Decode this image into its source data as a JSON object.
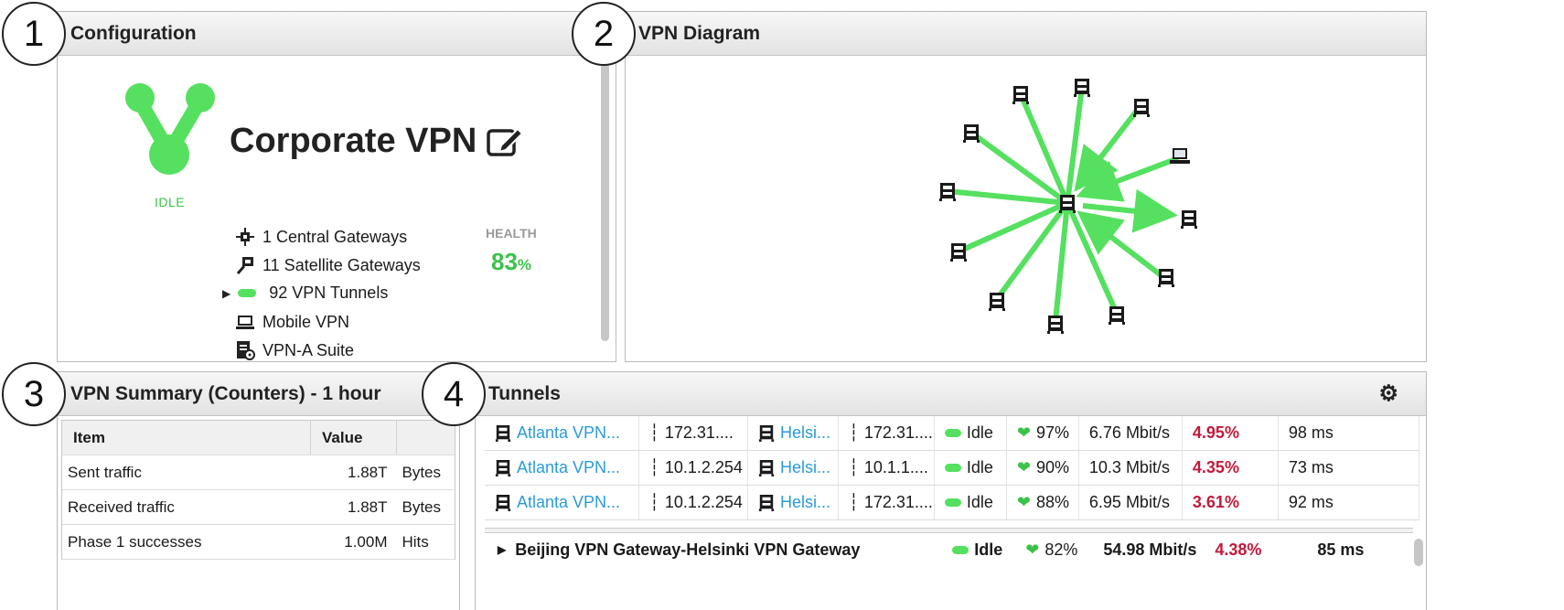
{
  "callouts": [
    "1",
    "2",
    "3",
    "4"
  ],
  "config": {
    "title": "Configuration",
    "vpn_name": "Corporate VPN",
    "status": "IDLE",
    "health_label": "HEALTH",
    "health_value": "83",
    "health_unit": "%",
    "items": [
      {
        "icon": "central-gateway-icon",
        "label": "1 Central Gateways"
      },
      {
        "icon": "satellite-gateway-icon",
        "label": "11 Satellite Gateways"
      },
      {
        "icon": "vpn-tunnel-icon",
        "label": "92 VPN Tunnels"
      },
      {
        "icon": "mobile-vpn-icon",
        "label": "Mobile VPN"
      },
      {
        "icon": "vpn-suite-icon",
        "label": "VPN-A Suite"
      }
    ],
    "colors": {
      "accent": "#55e060",
      "health": "#3cc24a"
    }
  },
  "diagram": {
    "title": "VPN Diagram"
  },
  "summary": {
    "title": "VPN Summary (Counters) - 1 hour",
    "headers": {
      "item": "Item",
      "value": "Value"
    },
    "rows": [
      {
        "item": "Sent traffic",
        "value": "1.88T",
        "unit": "Bytes"
      },
      {
        "item": "Received traffic",
        "value": "1.88T",
        "unit": "Bytes"
      },
      {
        "item": "Phase 1 successes",
        "value": "1.00M",
        "unit": "Hits"
      }
    ]
  },
  "tunnels": {
    "title": "Tunnels",
    "rows": [
      {
        "src": "Atlanta VPN...",
        "src_ip": "172.31....",
        "dst": "Helsi...",
        "dst_ip": "172.31....",
        "status": "Idle",
        "health": "97%",
        "rate": "6.76 Mbit/s",
        "loss": "4.95%",
        "latency": "98 ms"
      },
      {
        "src": "Atlanta VPN...",
        "src_ip": "10.1.2.254",
        "dst": "Helsi...",
        "dst_ip": "10.1.1....",
        "status": "Idle",
        "health": "90%",
        "rate": "10.3 Mbit/s",
        "loss": "4.35%",
        "latency": "73 ms"
      },
      {
        "src": "Atlanta VPN...",
        "src_ip": "10.1.2.254",
        "dst": "Helsi...",
        "dst_ip": "172.31....",
        "status": "Idle",
        "health": "88%",
        "rate": "6.95 Mbit/s",
        "loss": "3.61%",
        "latency": "92 ms"
      }
    ],
    "group": {
      "name": "Beijing VPN Gateway-Helsinki VPN Gateway",
      "status": "Idle",
      "health": "82%",
      "rate": "54.98 Mbit/s",
      "loss": "4.38%",
      "latency": "85 ms"
    }
  }
}
